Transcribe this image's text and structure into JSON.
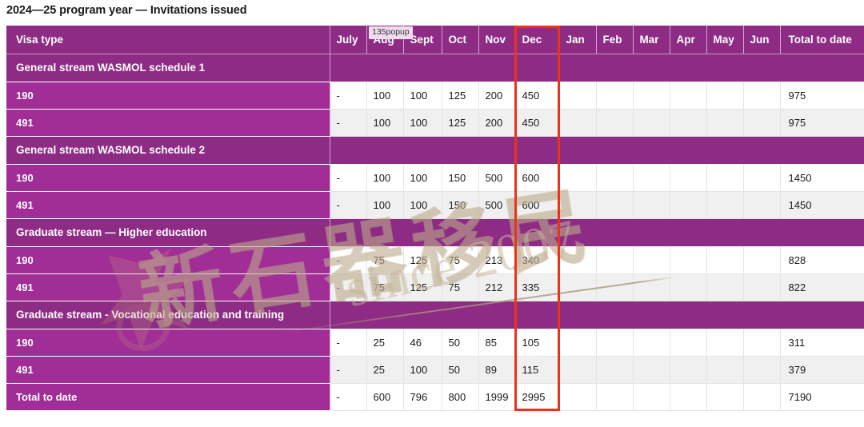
{
  "page": {
    "title": "2024—25 program year — Invitations issued"
  },
  "overlay": {
    "popup_badge": "135popup",
    "highlight_color": "#e8341a",
    "highlight_column": "Dec"
  },
  "watermark": {
    "cjk_text": "新石器移民",
    "since_text": "since 2007",
    "color": "#c4b294"
  },
  "theme": {
    "header_purple": "#8e2b84",
    "row_purple": "#a02e96",
    "row_white": "#ffffff",
    "row_alt_gray": "#f0f0f0",
    "grid_line": "#e3e3e3",
    "text_dark": "#1a1a1a",
    "text_light": "#ffffff"
  },
  "chart_data": {
    "type": "table",
    "title": "2024—25 program year — Invitations issued",
    "columns": [
      "Visa type",
      "July",
      "Aug",
      "Sept",
      "Oct",
      "Nov",
      "Dec",
      "Jan",
      "Feb",
      "Mar",
      "Apr",
      "May",
      "Jun",
      "Total to date"
    ],
    "rows": [
      {
        "kind": "section",
        "label": "General stream WASMOL schedule 1",
        "values": []
      },
      {
        "kind": "data",
        "label": "190",
        "values": [
          "-",
          "100",
          "100",
          "125",
          "200",
          "450",
          "",
          "",
          "",
          "",
          "",
          "",
          "975"
        ]
      },
      {
        "kind": "data",
        "label": "491",
        "values": [
          "-",
          "100",
          "100",
          "125",
          "200",
          "450",
          "",
          "",
          "",
          "",
          "",
          "",
          "975"
        ]
      },
      {
        "kind": "section",
        "label": "General stream WASMOL schedule 2",
        "values": []
      },
      {
        "kind": "data",
        "label": "190",
        "values": [
          "-",
          "100",
          "100",
          "150",
          "500",
          "600",
          "",
          "",
          "",
          "",
          "",
          "",
          "1450"
        ]
      },
      {
        "kind": "data",
        "label": "491",
        "values": [
          "-",
          "100",
          "100",
          "150",
          "500",
          "600",
          "",
          "",
          "",
          "",
          "",
          "",
          "1450"
        ]
      },
      {
        "kind": "section",
        "label": "Graduate stream — Higher education",
        "values": []
      },
      {
        "kind": "data",
        "label": "190",
        "values": [
          "-",
          "75",
          "125",
          "75",
          "213",
          "340",
          "",
          "",
          "",
          "",
          "",
          "",
          "828"
        ]
      },
      {
        "kind": "data",
        "label": "491",
        "values": [
          "-",
          "75",
          "125",
          "75",
          "212",
          "335",
          "",
          "",
          "",
          "",
          "",
          "",
          "822"
        ]
      },
      {
        "kind": "section",
        "label": "Graduate stream - Vocational education and training",
        "values": []
      },
      {
        "kind": "data",
        "label": "190",
        "values": [
          "-",
          "25",
          "46",
          "50",
          "85",
          "105",
          "",
          "",
          "",
          "",
          "",
          "",
          "311"
        ]
      },
      {
        "kind": "data",
        "label": "491",
        "values": [
          "-",
          "25",
          "100",
          "50",
          "89",
          "115",
          "",
          "",
          "",
          "",
          "",
          "",
          "379"
        ]
      },
      {
        "kind": "data",
        "label": "Total to date",
        "values": [
          "-",
          "600",
          "796",
          "800",
          "1999",
          "2995",
          "",
          "",
          "",
          "",
          "",
          "",
          "7190"
        ]
      }
    ]
  }
}
